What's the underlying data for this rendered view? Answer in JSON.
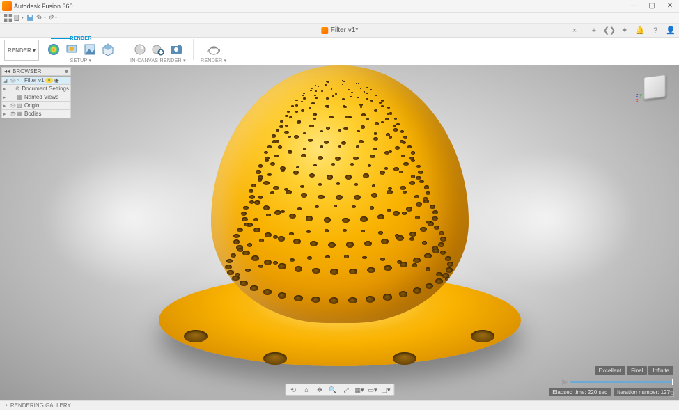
{
  "app": {
    "title": "Autodesk Fusion 360"
  },
  "window": {
    "min": "—",
    "max": "▢",
    "close": "✕"
  },
  "tab": {
    "doc_name": "Filter v1*",
    "close": "×",
    "plus": "+"
  },
  "workspaces_button": "RENDER ▾",
  "toolbar": {
    "render_group_label": "RENDER",
    "setup_label": "SETUP ▾",
    "incanvas_group_label": "IN-CANVAS RENDER ▾",
    "render_btn_label": "RENDER ▾"
  },
  "browser": {
    "title": "BROWSER",
    "root": "Filter v1",
    "root_badge": "●",
    "items": [
      {
        "label": "Document Settings"
      },
      {
        "label": "Named Views"
      },
      {
        "label": "Origin"
      },
      {
        "label": "Bodies"
      }
    ]
  },
  "navbar_icons": [
    "�⊹",
    "⌂",
    "👁",
    "🔍",
    "⤢",
    "▦",
    "▾",
    "▭",
    "▾"
  ],
  "render_controls": {
    "quality": [
      "Excellent",
      "Final",
      "Infinite"
    ],
    "elapsed": "Elapsed time: 220 sec",
    "iter": "Iteration number: 127"
  },
  "statusbar": {
    "text": "RENDERING GALLERY"
  }
}
